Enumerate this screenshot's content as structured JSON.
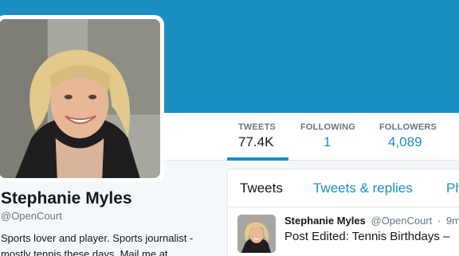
{
  "profile": {
    "name": "Stephanie Myles",
    "handle": "@OpenCourt",
    "bio": "Sports lover and player. Sports journalist - mostly tennis these days. Mail me at"
  },
  "stats": [
    {
      "label": "TWEETS",
      "value": "77.4K"
    },
    {
      "label": "FOLLOWING",
      "value": "1"
    },
    {
      "label": "FOLLOWERS",
      "value": "4,089"
    }
  ],
  "tabs": [
    {
      "label": "Tweets"
    },
    {
      "label": "Tweets & replies"
    },
    {
      "label": "Ph"
    }
  ],
  "tweet": {
    "name": "Stephanie Myles",
    "handle": "@OpenCourt",
    "separator": "·",
    "time": "9m",
    "text": "Post Edited: Tennis Birthdays –",
    "more": "‥"
  },
  "colors": {
    "banner": "#1b8ec3",
    "accent": "#1b8ec3",
    "muted": "#657786"
  }
}
